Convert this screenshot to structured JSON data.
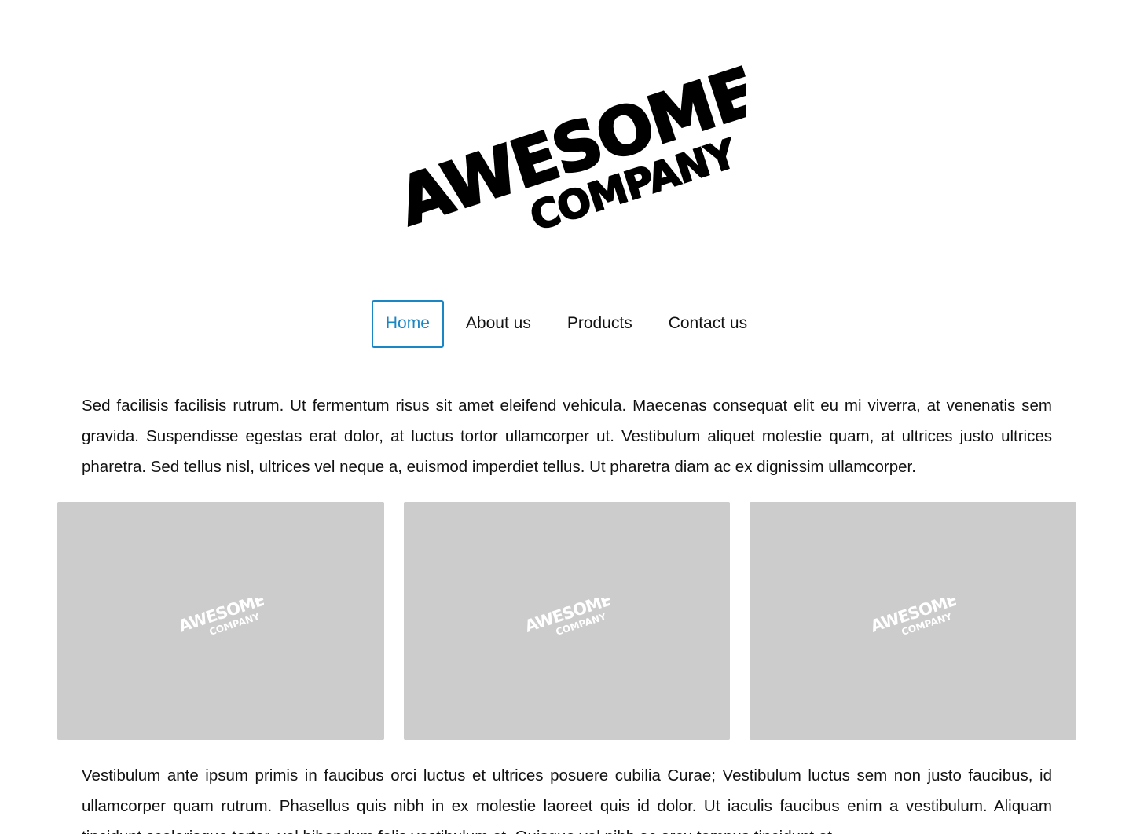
{
  "logo": {
    "line1": "AWESOME",
    "line2": "COMPANY"
  },
  "nav": {
    "items": [
      {
        "label": "Home",
        "active": true
      },
      {
        "label": "About us",
        "active": false
      },
      {
        "label": "Products",
        "active": false
      },
      {
        "label": "Contact us",
        "active": false
      }
    ]
  },
  "intro": {
    "text": "Sed facilisis facilisis rutrum. Ut fermentum risus sit amet eleifend vehicula. Maecenas consequat elit eu mi viverra, at venenatis sem gravida. Suspendisse egestas erat dolor, at luctus tortor ullamcorper ut. Vestibulum aliquet molestie quam, at ultrices justo ultrices pharetra. Sed tellus nisl, ultrices vel neque a, euismod imperdiet tellus. Ut pharetra diam ac ex dignissim ullamcorper."
  },
  "cards": [
    {
      "logo_line1": "AWESOME",
      "logo_line2": "COMPANY"
    },
    {
      "logo_line1": "AWESOME",
      "logo_line2": "COMPANY"
    },
    {
      "logo_line1": "AWESOME",
      "logo_line2": "COMPANY"
    }
  ],
  "body2": {
    "text": "Vestibulum ante ipsum primis in faucibus orci luctus et ultrices posuere cubilia Curae; Vestibulum luctus sem non justo faucibus, id ullamcorper quam rutrum. Phasellus quis nibh in ex molestie laoreet quis id dolor. Ut iaculis faucibus enim a vestibulum. Aliquam tincidunt scelerisque tortor, vel bibendum felis vestibulum et. Quisque vel nibh ac arcu tempus tincidunt et."
  },
  "colors": {
    "accent": "#1a86c4",
    "card_bg": "#cccccc",
    "text": "#111111"
  }
}
